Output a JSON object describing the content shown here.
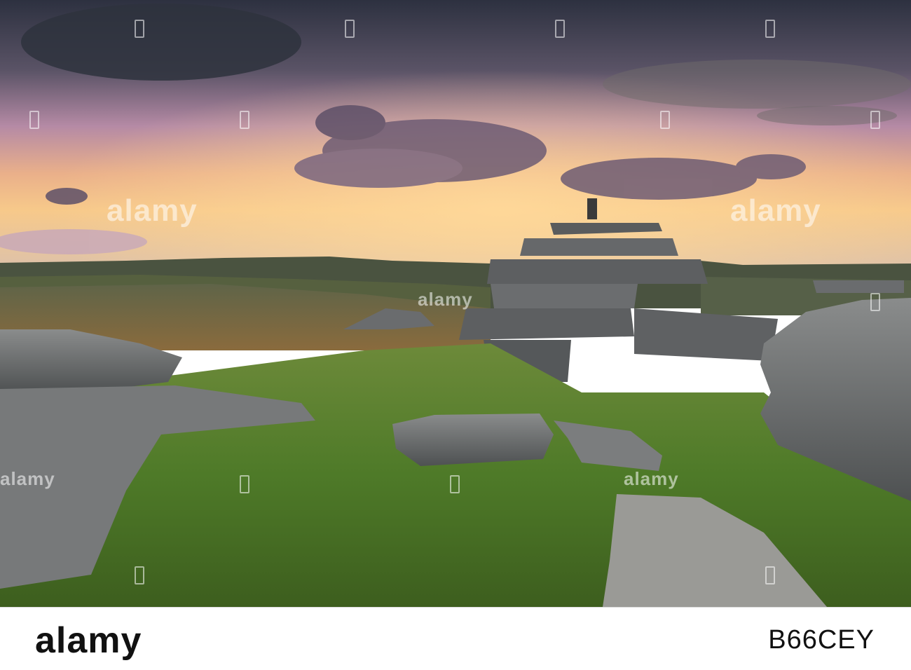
{
  "photo": {
    "subject": "",
    "watermark_text": "alamy",
    "colors": {
      "sky_top": "#3a3b4a",
      "sky_mid": "#b58aa5",
      "sky_glow": "#f7c27a",
      "hills": "#4e5a3c",
      "grass": "#5f8a2e",
      "rock": "#6f7172"
    }
  },
  "footer": {
    "logo": "alamy",
    "image_id": "B66CEY"
  }
}
